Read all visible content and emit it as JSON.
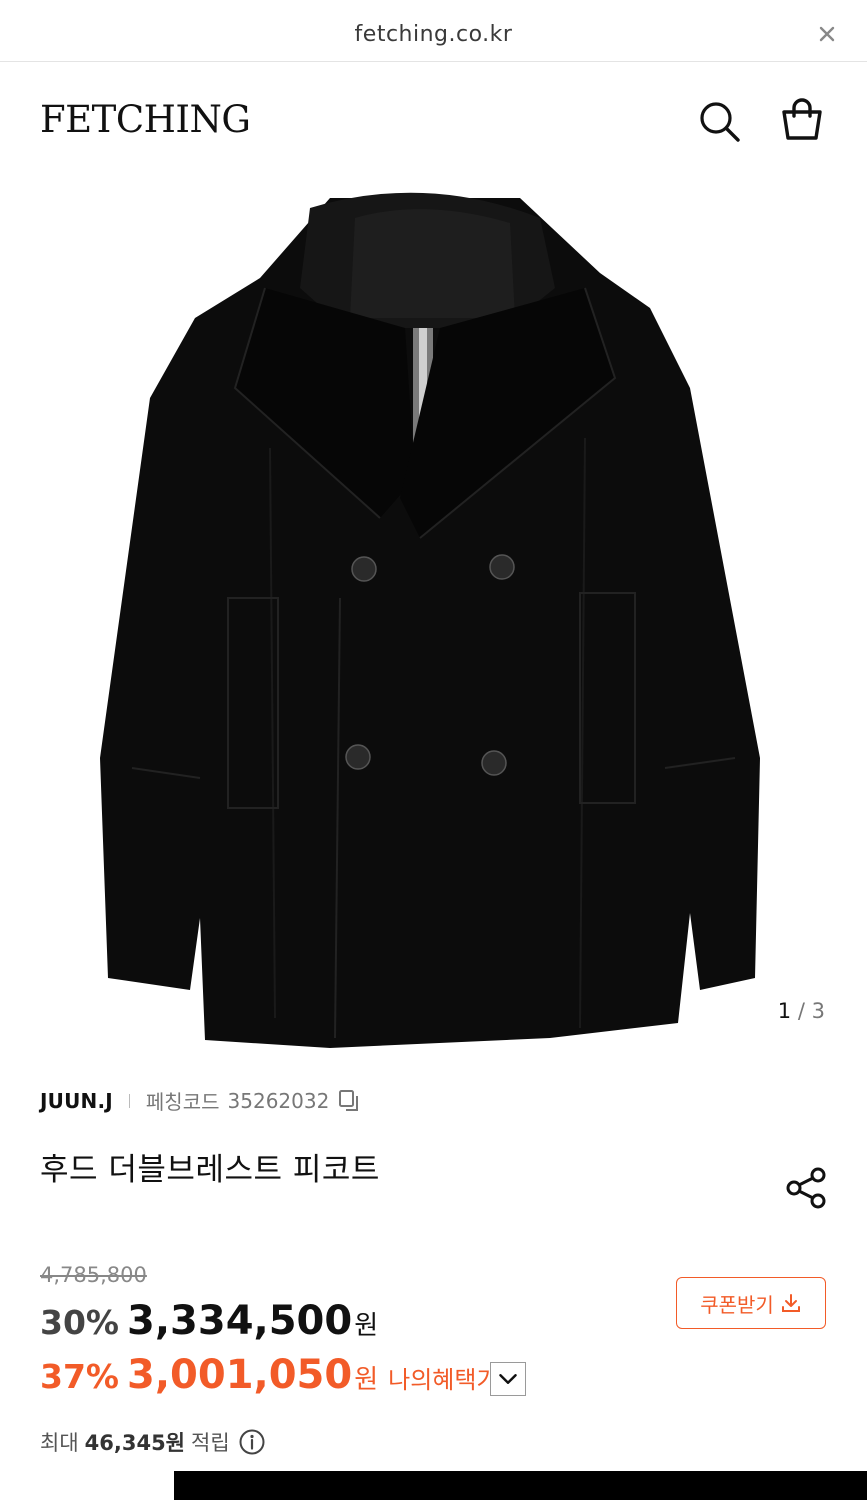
{
  "browser": {
    "url": "fetching.co.kr",
    "close_icon": "close-icon"
  },
  "header": {
    "logo": "FETCHING",
    "search_icon": "search-icon",
    "bag_icon": "shopping-bag-icon"
  },
  "gallery": {
    "current": "1",
    "divider": "/",
    "total": "3"
  },
  "product": {
    "brand": "JUUN.J",
    "code_label": "페칭코드",
    "code": "35262032",
    "title": "후드 더블브레스트 피코트"
  },
  "pricing": {
    "original": "4,785,800",
    "discount_pct": "30%",
    "discount_price": "3,334,500",
    "currency": "원",
    "my_pct": "37%",
    "my_price": "3,001,050",
    "my_currency": "원",
    "my_label": "나의혜택가",
    "coupon_label": "쿠폰받기",
    "accent_color": "#f25b28"
  },
  "points": {
    "prefix": "최대",
    "value": "46,345원",
    "suffix": "적립"
  }
}
